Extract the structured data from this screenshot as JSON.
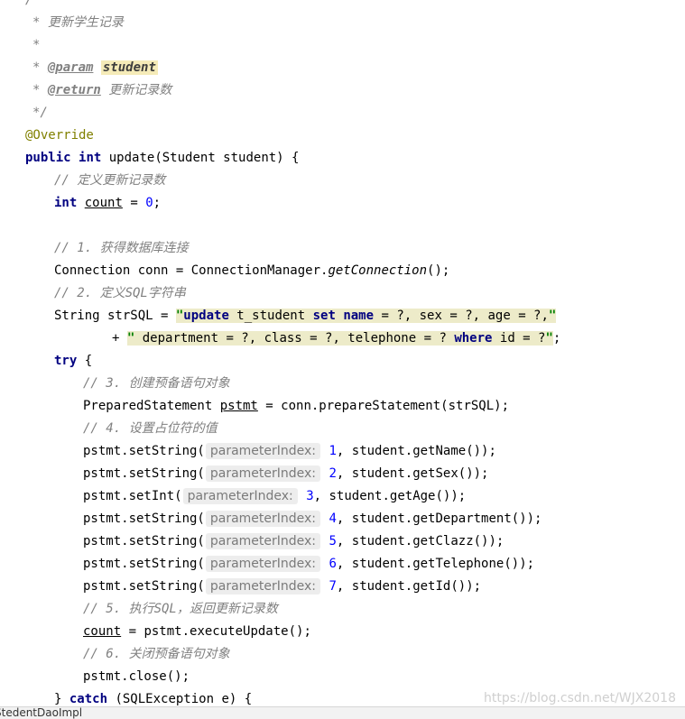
{
  "editor": {
    "lines": [
      {
        "indent": 28,
        "tokens": [
          {
            "t": "/**",
            "c": "cm"
          }
        ]
      },
      {
        "indent": 36,
        "tokens": [
          {
            "t": "* 更新学生记录",
            "c": "cm"
          }
        ]
      },
      {
        "indent": 36,
        "tokens": [
          {
            "t": "*",
            "c": "cm"
          }
        ]
      },
      {
        "indent": 36,
        "tokens": [
          {
            "t": "* ",
            "c": "cm"
          },
          {
            "t": "@param",
            "c": "tag"
          },
          {
            "t": " ",
            "c": "cm"
          },
          {
            "t": "student",
            "c": "pname"
          }
        ]
      },
      {
        "indent": 36,
        "tokens": [
          {
            "t": "* ",
            "c": "cm"
          },
          {
            "t": "@return",
            "c": "tag"
          },
          {
            "t": " 更新记录数",
            "c": "cm"
          }
        ]
      },
      {
        "indent": 36,
        "tokens": [
          {
            "t": "*/",
            "c": "cm"
          }
        ]
      },
      {
        "indent": 28,
        "tokens": [
          {
            "t": "@Override",
            "c": "ann"
          }
        ]
      },
      {
        "indent": 28,
        "tokens": [
          {
            "t": "public",
            "c": "kw"
          },
          {
            "t": " "
          },
          {
            "t": "int",
            "c": "kw"
          },
          {
            "t": " update(Student student) {"
          }
        ]
      },
      {
        "indent": 60,
        "tokens": [
          {
            "t": "// 定义更新记录数",
            "c": "cm"
          }
        ]
      },
      {
        "indent": 60,
        "tokens": [
          {
            "t": "int",
            "c": "kw"
          },
          {
            "t": " "
          },
          {
            "t": "count",
            "c": "ul"
          },
          {
            "t": " = "
          },
          {
            "t": "0",
            "c": "num"
          },
          {
            "t": ";"
          }
        ]
      },
      {
        "indent": 60,
        "tokens": []
      },
      {
        "indent": 60,
        "tokens": [
          {
            "t": "// 1. 获得数据库连接",
            "c": "cm"
          }
        ]
      },
      {
        "indent": 60,
        "tokens": [
          {
            "t": "Connection conn = ConnectionManager."
          },
          {
            "t": "getConnection",
            "c": "it"
          },
          {
            "t": "();"
          }
        ]
      },
      {
        "indent": 60,
        "tokens": [
          {
            "t": "// 2. 定义SQL字符串",
            "c": "cm"
          }
        ]
      },
      {
        "indent": 60,
        "tokens": [
          {
            "t": "String strSQL = "
          },
          {
            "t": "\"",
            "c": "str sqlbg"
          },
          {
            "t": "update",
            "c": "sqlkw sqlbg"
          },
          {
            "t": " t_student ",
            "c": "sqlbg"
          },
          {
            "t": "set",
            "c": "sqlkw sqlbg"
          },
          {
            "t": " ",
            "c": "sqlbg"
          },
          {
            "t": "name",
            "c": "sqlkw sqlbg"
          },
          {
            "t": " = ?, sex = ?, age = ?,",
            "c": "sqlbg"
          },
          {
            "t": "\"",
            "c": "str sqlbg"
          }
        ]
      },
      {
        "indent": 124,
        "tokens": [
          {
            "t": "+ "
          },
          {
            "t": "\"",
            "c": "str sqlbg"
          },
          {
            "t": " department = ?, class = ?, telephone = ? ",
            "c": "sqlbg"
          },
          {
            "t": "where",
            "c": "sqlkw sqlbg"
          },
          {
            "t": " id = ?",
            "c": "sqlbg"
          },
          {
            "t": "\"",
            "c": "str sqlbg"
          },
          {
            "t": ";"
          }
        ]
      },
      {
        "indent": 60,
        "tokens": [
          {
            "t": "try",
            "c": "kw"
          },
          {
            "t": " {"
          }
        ]
      },
      {
        "indent": 92,
        "tokens": [
          {
            "t": "// 3. 创建预备语句对象",
            "c": "cm"
          }
        ]
      },
      {
        "indent": 92,
        "tokens": [
          {
            "t": "PreparedStatement "
          },
          {
            "t": "pstmt",
            "c": "ul"
          },
          {
            "t": " = conn.prepareStatement(strSQL);"
          }
        ]
      },
      {
        "indent": 92,
        "tokens": [
          {
            "t": "// 4. 设置占位符的值",
            "c": "cm"
          }
        ]
      },
      {
        "indent": 92,
        "tokens": [
          {
            "t": "pstmt.setString("
          },
          {
            "t": "parameterIndex:",
            "c": "hint"
          },
          {
            "t": " "
          },
          {
            "t": "1",
            "c": "num"
          },
          {
            "t": ", student.getName());"
          }
        ]
      },
      {
        "indent": 92,
        "tokens": [
          {
            "t": "pstmt.setString("
          },
          {
            "t": "parameterIndex:",
            "c": "hint"
          },
          {
            "t": " "
          },
          {
            "t": "2",
            "c": "num"
          },
          {
            "t": ", student.getSex());"
          }
        ]
      },
      {
        "indent": 92,
        "tokens": [
          {
            "t": "pstmt.setInt("
          },
          {
            "t": "parameterIndex:",
            "c": "hint"
          },
          {
            "t": " "
          },
          {
            "t": "3",
            "c": "num"
          },
          {
            "t": ", student.getAge());"
          }
        ]
      },
      {
        "indent": 92,
        "tokens": [
          {
            "t": "pstmt.setString("
          },
          {
            "t": "parameterIndex:",
            "c": "hint"
          },
          {
            "t": " "
          },
          {
            "t": "4",
            "c": "num"
          },
          {
            "t": ", student.getDepartment());"
          }
        ]
      },
      {
        "indent": 92,
        "tokens": [
          {
            "t": "pstmt.setString("
          },
          {
            "t": "parameterIndex:",
            "c": "hint"
          },
          {
            "t": " "
          },
          {
            "t": "5",
            "c": "num"
          },
          {
            "t": ", student.getClazz());"
          }
        ]
      },
      {
        "indent": 92,
        "tokens": [
          {
            "t": "pstmt.setString("
          },
          {
            "t": "parameterIndex:",
            "c": "hint"
          },
          {
            "t": " "
          },
          {
            "t": "6",
            "c": "num"
          },
          {
            "t": ", student.getTelephone());"
          }
        ]
      },
      {
        "indent": 92,
        "tokens": [
          {
            "t": "pstmt.setString("
          },
          {
            "t": "parameterIndex:",
            "c": "hint"
          },
          {
            "t": " "
          },
          {
            "t": "7",
            "c": "num"
          },
          {
            "t": ", student.getId());"
          }
        ]
      },
      {
        "indent": 92,
        "tokens": [
          {
            "t": "// 5. 执行SQL，返回更新记录数",
            "c": "cm"
          }
        ]
      },
      {
        "indent": 92,
        "tokens": [
          {
            "t": "count",
            "c": "ul"
          },
          {
            "t": " = pstmt.executeUpdate();"
          }
        ]
      },
      {
        "indent": 92,
        "tokens": [
          {
            "t": "// 6. 关闭预备语句对象",
            "c": "cm"
          }
        ]
      },
      {
        "indent": 92,
        "tokens": [
          {
            "t": "pstmt.close();"
          }
        ]
      },
      {
        "indent": 60,
        "tokens": [
          {
            "t": "} "
          },
          {
            "t": "catch",
            "c": "kw"
          },
          {
            "t": " (SQLException e) {"
          }
        ]
      }
    ]
  },
  "watermark": "https://blog.csdn.net/WJX2018",
  "status": {
    "file_tab": "StedentDaoImpl"
  }
}
